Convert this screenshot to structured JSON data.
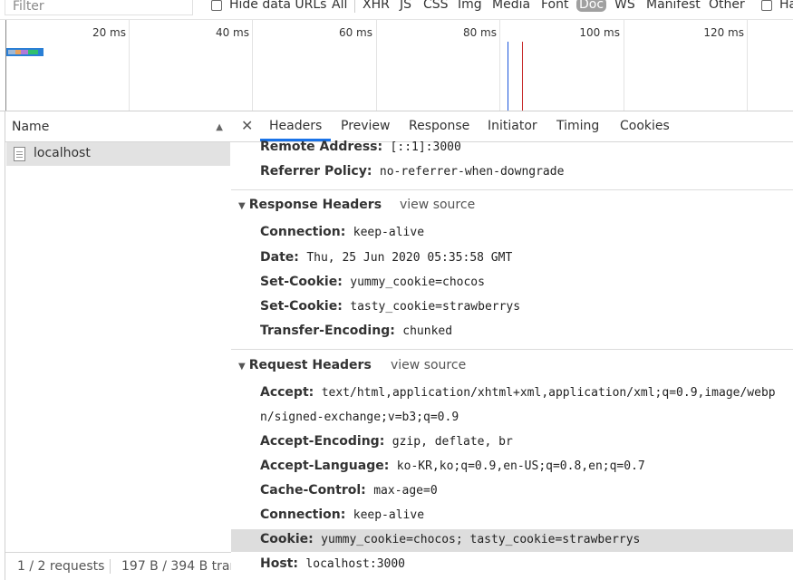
{
  "filterbar": {
    "placeholder": "Filter",
    "hide_data_urls": "Hide data URLs",
    "types": [
      "All",
      "XHR",
      "JS",
      "CSS",
      "Img",
      "Media",
      "Font",
      "Doc",
      "WS",
      "Manifest",
      "Other"
    ],
    "active_type": "Doc",
    "trailing_checkbox_label": "Ha"
  },
  "overview": {
    "ticks": [
      "20 ms",
      "40 ms",
      "60 ms",
      "80 ms",
      "100 ms",
      "120 ms"
    ],
    "colors": {
      "dom_content_loaded": "#1a56db",
      "load": "#c62828"
    }
  },
  "request_list": {
    "header": "Name",
    "requests": [
      {
        "name": "localhost"
      }
    ],
    "status_requests": "1 / 2 requests",
    "status_transfer": "197 B / 394 B tran"
  },
  "details": {
    "tabs": [
      "Headers",
      "Preview",
      "Response",
      "Initiator",
      "Timing",
      "Cookies"
    ],
    "active_tab": "Headers",
    "general": [
      {
        "key": "Remote Address:",
        "value": "[::1]:3000"
      },
      {
        "key": "Referrer Policy:",
        "value": "no-referrer-when-downgrade"
      }
    ],
    "response_headers": {
      "title": "Response Headers",
      "view_source": "view source",
      "items": [
        {
          "key": "Connection:",
          "value": "keep-alive"
        },
        {
          "key": "Date:",
          "value": "Thu, 25 Jun 2020 05:35:58 GMT"
        },
        {
          "key": "Set-Cookie:",
          "value": "yummy_cookie=chocos"
        },
        {
          "key": "Set-Cookie:",
          "value": "tasty_cookie=strawberrys"
        },
        {
          "key": "Transfer-Encoding:",
          "value": "chunked"
        }
      ]
    },
    "request_headers": {
      "title": "Request Headers",
      "view_source": "view source",
      "accept_key": "Accept:",
      "accept_value_line1": "text/html,application/xhtml+xml,application/xml;q=0.9,image/webp",
      "accept_value_line2": "n/signed-exchange;v=b3;q=0.9",
      "items": [
        {
          "key": "Accept-Encoding:",
          "value": "gzip, deflate, br"
        },
        {
          "key": "Accept-Language:",
          "value": "ko-KR,ko;q=0.9,en-US;q=0.8,en;q=0.7"
        },
        {
          "key": "Cache-Control:",
          "value": "max-age=0"
        },
        {
          "key": "Connection:",
          "value": "keep-alive"
        },
        {
          "key": "Cookie:",
          "value": "yummy_cookie=chocos; tasty_cookie=strawberrys"
        },
        {
          "key": "Host:",
          "value": "localhost:3000"
        }
      ],
      "highlighted_index": 4
    }
  }
}
